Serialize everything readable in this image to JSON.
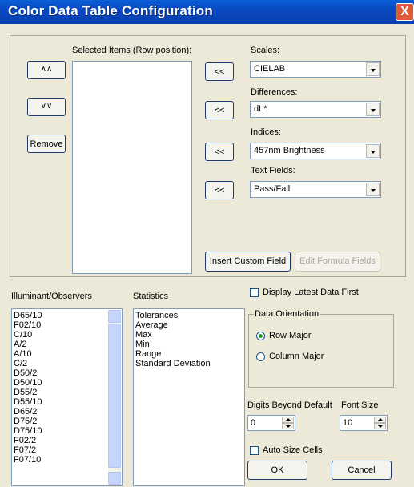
{
  "window": {
    "title": "Color Data Table Configuration",
    "close_label": "X"
  },
  "selected": {
    "label": "Selected Items (Row position):",
    "up_label": "∧∧",
    "down_label": "∨∨",
    "remove_label": "Remove"
  },
  "scales": {
    "label": "Scales:",
    "value": "CIELAB",
    "add_label": "<<"
  },
  "differences": {
    "label": "Differences:",
    "value": "dL*",
    "add_label": "<<"
  },
  "indices": {
    "label": "Indices:",
    "value": "457nm Brightness",
    "add_label": "<<"
  },
  "textfields": {
    "label": "Text Fields:",
    "value": "Pass/Fail",
    "add_label": "<<"
  },
  "custom": {
    "insert_label": "Insert Custom Field",
    "edit_label": "Edit Formula Fields"
  },
  "illuminant": {
    "label": "Illuminant/Observers",
    "items": [
      "D65/10",
      "F02/10",
      "C/10",
      "A/2",
      "A/10",
      "C/2",
      "D50/2",
      "D50/10",
      "D55/2",
      "D55/10",
      "D65/2",
      "D75/2",
      "D75/10",
      "F02/2",
      "F07/2",
      "F07/10"
    ]
  },
  "statistics": {
    "label": "Statistics",
    "items": [
      "Tolerances",
      "Average",
      "Max",
      "Min",
      "Range",
      "Standard Deviation"
    ]
  },
  "options": {
    "display_latest": "Display Latest Data First",
    "orientation_label": "Data Orientation",
    "row_major": "Row Major",
    "column_major": "Column Major",
    "digits_label": "Digits Beyond Default",
    "digits_value": "0",
    "fontsize_label": "Font Size",
    "fontsize_value": "10",
    "autosize": "Auto Size Cells"
  },
  "footer": {
    "ok_label": "OK",
    "cancel_label": "Cancel"
  },
  "colors": {
    "title_bar": "#0a5fd8",
    "close_button": "#e05a3a",
    "dialog_bg": "#ece9d8"
  }
}
